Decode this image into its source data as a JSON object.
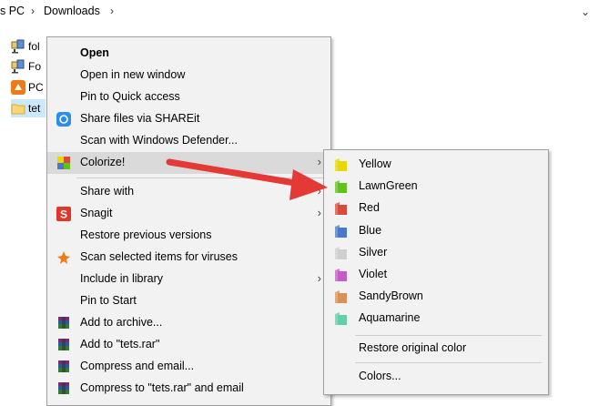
{
  "breadcrumb": {
    "this_pc": "s PC",
    "downloads": "Downloads",
    "sep": "›",
    "dropdown": "⌄"
  },
  "files": [
    {
      "label": "fol",
      "icon": "network-folder-icon"
    },
    {
      "label": "Fo",
      "icon": "network-folder-icon"
    },
    {
      "label": "PC",
      "icon": "avast-icon"
    },
    {
      "label": "tet",
      "icon": "folder-icon"
    }
  ],
  "menu": {
    "open": "Open",
    "open_new_window": "Open in new window",
    "pin_quick_access": "Pin to Quick access",
    "shareit": "Share files via SHAREit",
    "defender": "Scan with Windows Defender...",
    "colorize": "Colorize!",
    "share_with": "Share with",
    "snagit": "Snagit",
    "restore_versions": "Restore previous versions",
    "scan_viruses": "Scan selected items for viruses",
    "include_library": "Include in library",
    "pin_start": "Pin to Start",
    "add_archive": "Add to archive...",
    "add_tets_rar": "Add to \"tets.rar\"",
    "compress_email": "Compress and email...",
    "compress_tets_email": "Compress to \"tets.rar\" and email",
    "submenu_arrow": "›"
  },
  "colorize_submenu": {
    "colors": [
      {
        "label": "Yellow",
        "color": "#e6d800"
      },
      {
        "label": "LawnGreen",
        "color": "#5fc31b"
      },
      {
        "label": "Red",
        "color": "#d84a3a"
      },
      {
        "label": "Blue",
        "color": "#4a78c9"
      },
      {
        "label": "Silver",
        "color": "#cfcfcf"
      },
      {
        "label": "Violet",
        "color": "#c45bc9"
      },
      {
        "label": "SandyBrown",
        "color": "#d99155"
      },
      {
        "label": "Aquamarine",
        "color": "#62cfa8"
      }
    ],
    "restore": "Restore original color",
    "colors_more": "Colors..."
  },
  "annotation": {
    "arrow_color": "#e53935"
  }
}
